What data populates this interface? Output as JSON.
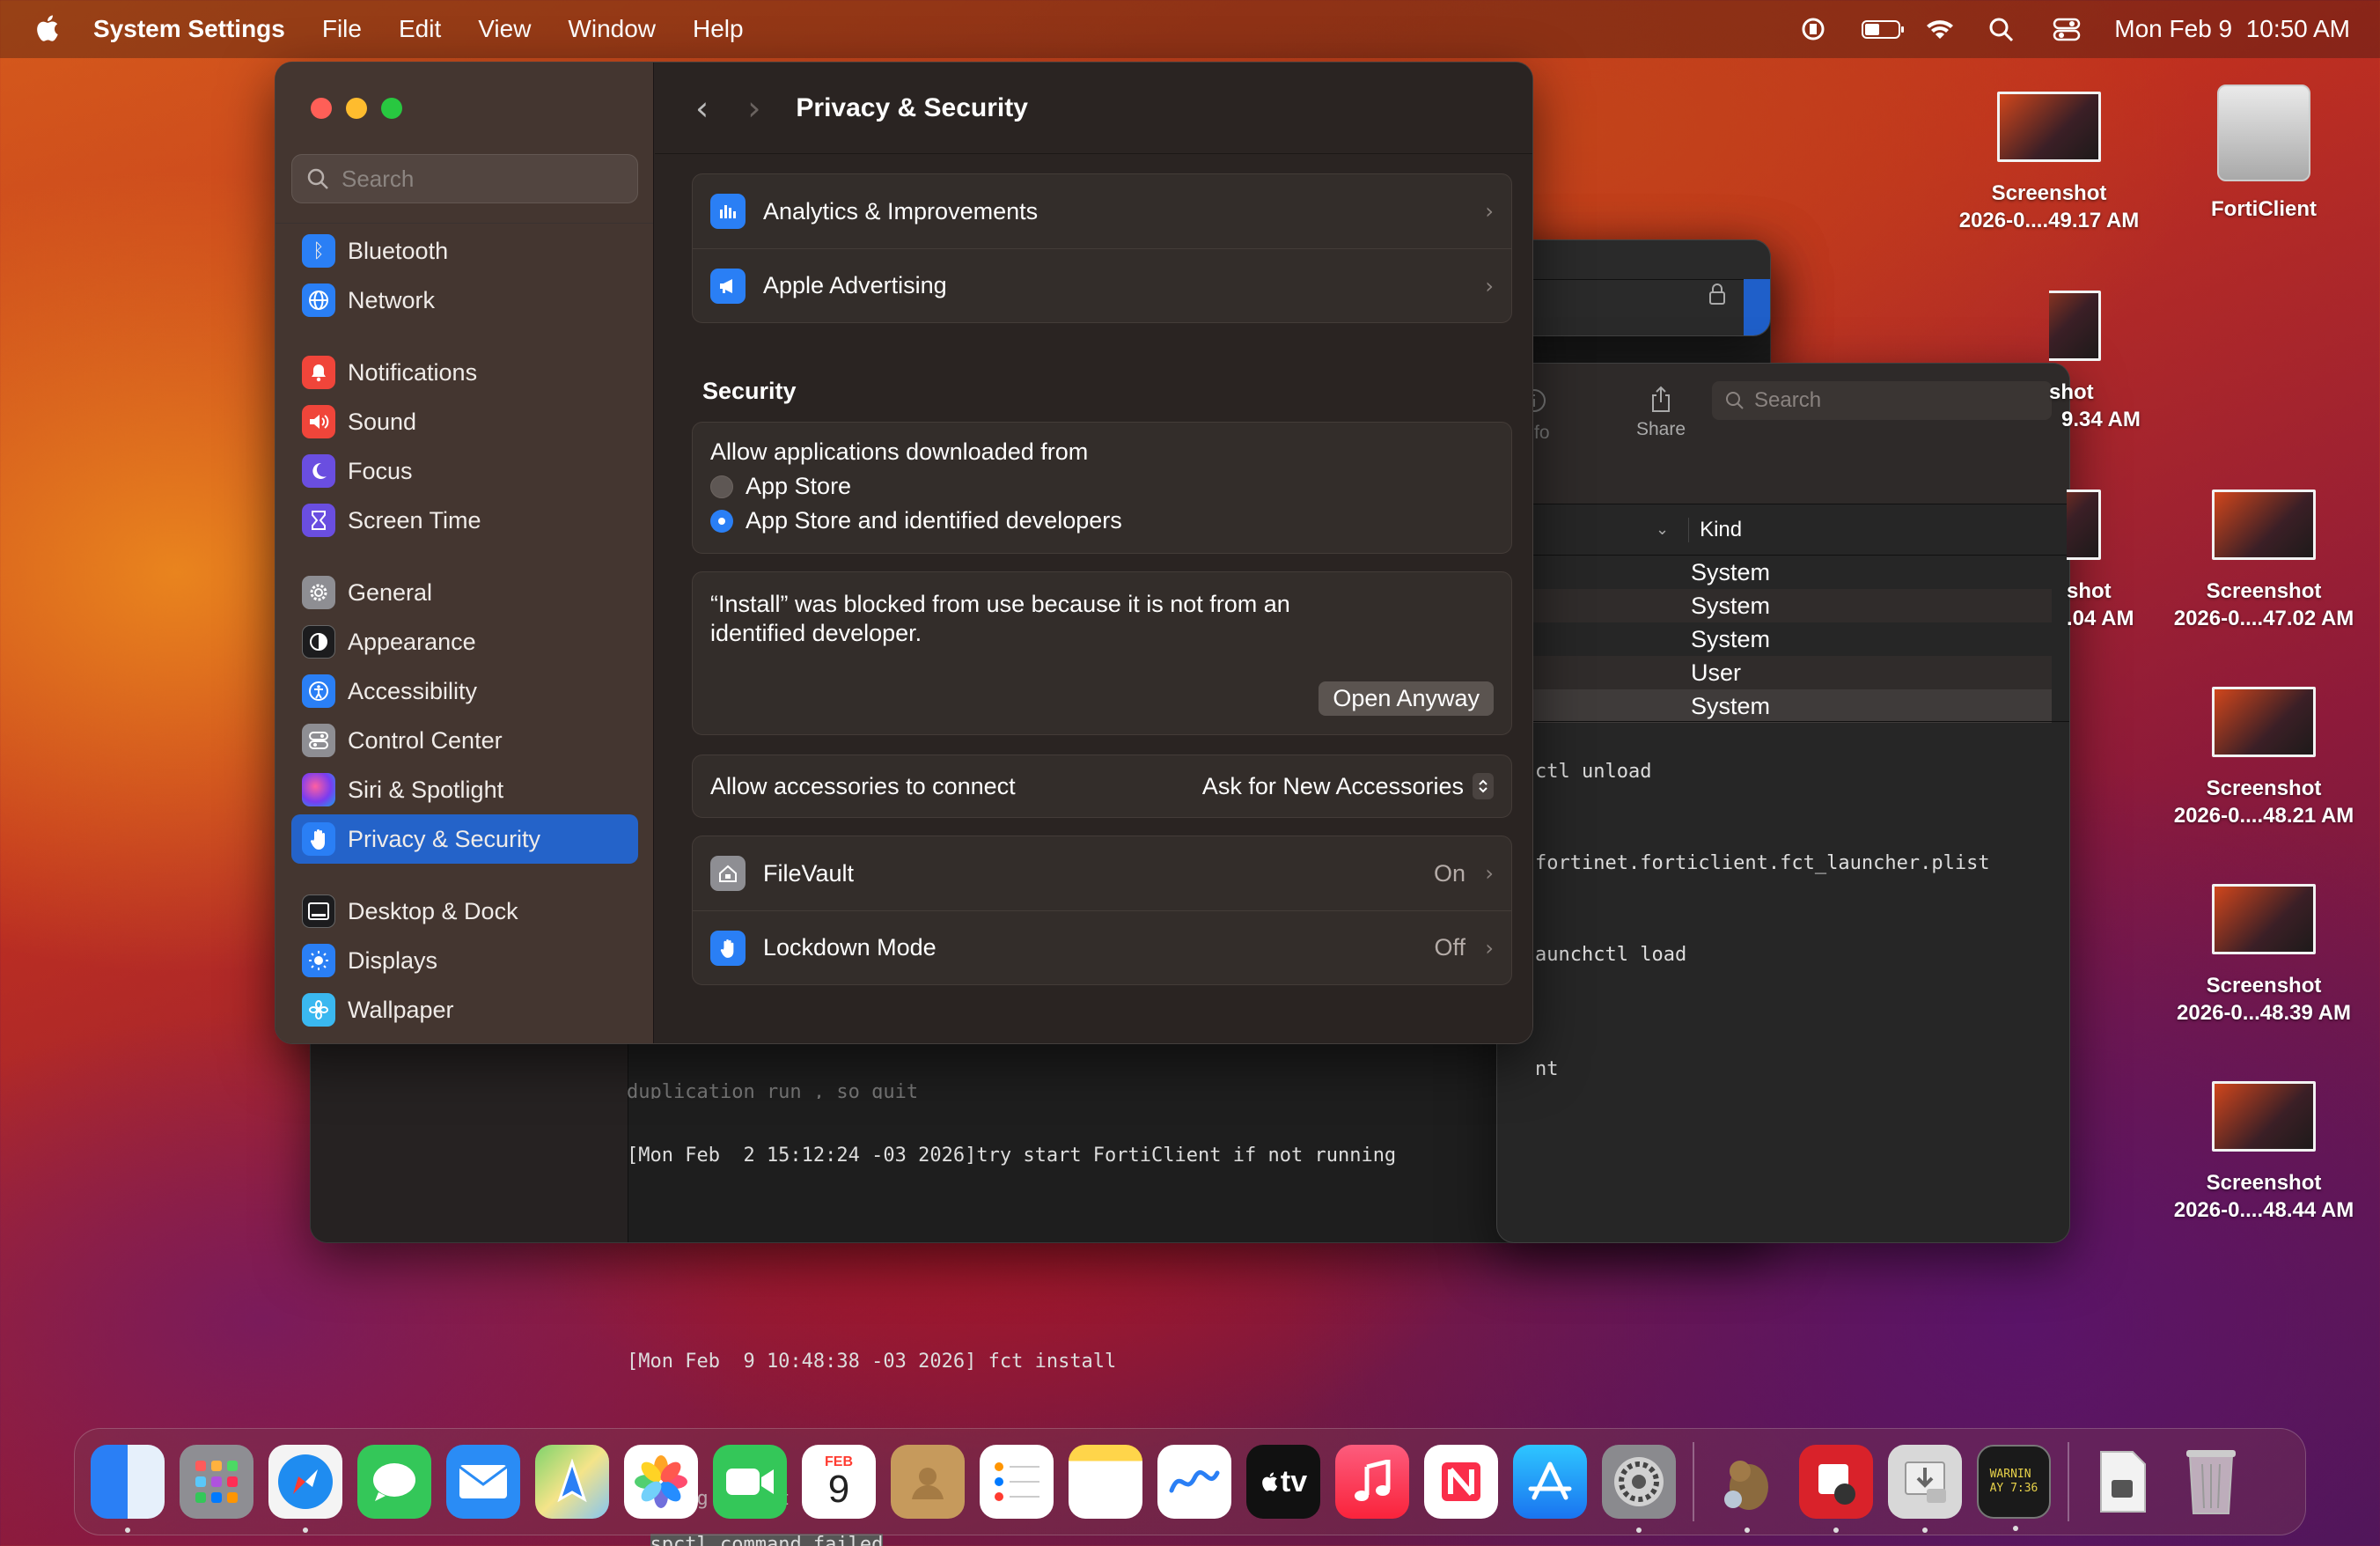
{
  "menubar": {
    "app_name": "System Settings",
    "menus": [
      "File",
      "Edit",
      "View",
      "Window",
      "Help"
    ],
    "datetime": "Mon Feb 9  10:50 AM"
  },
  "sidebar": {
    "search_placeholder": "Search",
    "items": [
      {
        "label": "Bluetooth",
        "icon": "bluetooth-icon",
        "color": "#2a7ff5"
      },
      {
        "label": "Network",
        "icon": "globe-icon",
        "color": "#2a7ff5"
      },
      {
        "label": "Notifications",
        "icon": "bell-icon",
        "color": "#f0453a"
      },
      {
        "label": "Sound",
        "icon": "speaker-icon",
        "color": "#f0453a"
      },
      {
        "label": "Focus",
        "icon": "moon-icon",
        "color": "#6a4ee0"
      },
      {
        "label": "Screen Time",
        "icon": "hourglass-icon",
        "color": "#6a4ee0"
      },
      {
        "label": "General",
        "icon": "gear-icon",
        "color": "#8e8e93"
      },
      {
        "label": "Appearance",
        "icon": "appearance-icon",
        "color": "#1c1c1e"
      },
      {
        "label": "Accessibility",
        "icon": "accessibility-icon",
        "color": "#2a7ff5"
      },
      {
        "label": "Control Center",
        "icon": "control-center-icon",
        "color": "#8e8e93"
      },
      {
        "label": "Siri & Spotlight",
        "icon": "siri-icon",
        "color": "#b044d0"
      },
      {
        "label": "Privacy & Security",
        "icon": "hand-icon",
        "color": "#2a7ff5"
      },
      {
        "label": "Desktop & Dock",
        "icon": "dock-icon",
        "color": "#1c1c1e"
      },
      {
        "label": "Displays",
        "icon": "sun-icon",
        "color": "#2a7ff5"
      },
      {
        "label": "Wallpaper",
        "icon": "wallpaper-icon",
        "color": "#3ab8f0"
      }
    ]
  },
  "content": {
    "title": "Privacy & Security",
    "privacy_rows": [
      {
        "label": "Analytics & Improvements"
      },
      {
        "label": "Apple Advertising"
      }
    ],
    "security_heading": "Security",
    "allow_label": "Allow applications downloaded from",
    "radio_app_store": "App Store",
    "radio_identified": "App Store and identified developers",
    "blocked_message": "“Install” was blocked from use because it is not from an identified developer.",
    "open_anyway": "Open Anyway",
    "accessories_label": "Allow accessories to connect",
    "accessories_value": "Ask for New Accessories",
    "filevault_label": "FileVault",
    "filevault_value": "On",
    "lockdown_label": "Lockdown Mode",
    "lockdown_value": "Off"
  },
  "finder": {
    "info": "Info",
    "share": "Share",
    "search_placeholder": "Search",
    "kind_header": "Kind",
    "kinds": [
      "System",
      "System",
      "System",
      "User",
      "System"
    ]
  },
  "terminal": {
    "partial_lines": [
      "ctl unload",
      "fortinet.forticlient.fct_launcher.plist",
      "aunchctl load",
      "nt"
    ],
    "lines": [
      "duplication run , so quit",
      "[Mon Feb  2 15:12:24 -03 2026]try start FortiClient if not running",
      "",
      "",
      "[Mon Feb  9 10:48:38 -03 2026] fct install",
      "",
      "running script",
      "spctl command failed"
    ]
  },
  "desktop": {
    "items": [
      {
        "label1": "Screenshot",
        "label2": "2026-0....49.17 AM"
      },
      {
        "label1": "FortiClient",
        "label2": ""
      },
      {
        "label1": "shot",
        "label2": "9.34 AM"
      },
      {
        "label1": "shot",
        "label2": ".04 AM"
      },
      {
        "label1": "Screenshot",
        "label2": "2026-0....47.02 AM"
      },
      {
        "label1": "Screenshot",
        "label2": "2026-0....48.21 AM"
      },
      {
        "label1": "Screenshot",
        "label2": "2026-0...48.39 AM"
      },
      {
        "label1": "Screenshot",
        "label2": "2026-0....48.44 AM"
      }
    ]
  },
  "dock": {
    "calendar_month": "FEB",
    "calendar_day": "9",
    "appletv_label": "tv",
    "console_text": "WARNIN\nAY 7:36"
  }
}
